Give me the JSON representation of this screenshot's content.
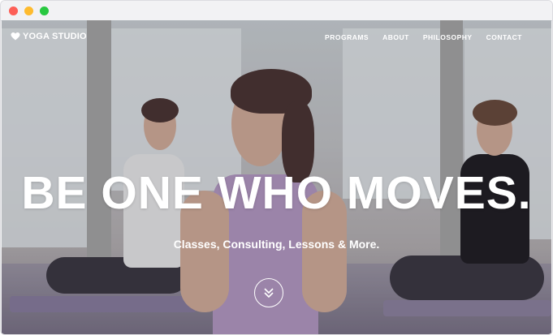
{
  "window": {
    "controls": [
      "close",
      "minimize",
      "maximize"
    ]
  },
  "nav": {
    "logo_icon": "heart-icon",
    "logo_text": "YOGA STUDIO",
    "items": [
      {
        "label": "PROGRAMS"
      },
      {
        "label": "ABOUT"
      },
      {
        "label": "PHILOSOPHY"
      },
      {
        "label": "CONTACT"
      }
    ]
  },
  "hero": {
    "headline": "BE ONE WHO MOVES.",
    "subline": "Classes, Consulting, Lessons & More.",
    "scroll_icon": "double-chevron-down-icon"
  },
  "colors": {
    "close": "#fd5f57",
    "minimize": "#febb2e",
    "maximize": "#28c840",
    "text": "#ffffff"
  }
}
